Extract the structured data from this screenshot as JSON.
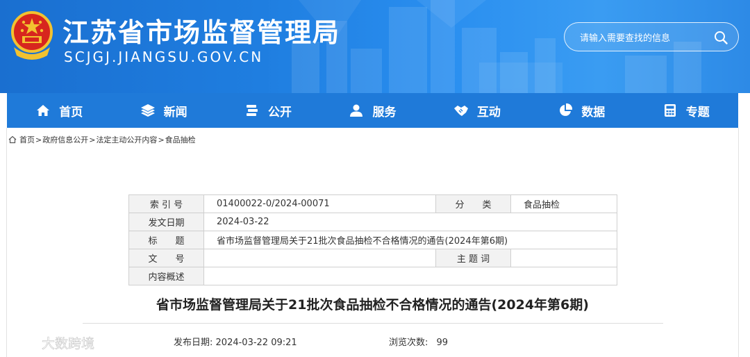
{
  "header": {
    "site_title": "江苏省市场监督管理局",
    "site_domain": "SCJGJ.JIANGSU.GOV.CN",
    "search_placeholder": "请输入需要查找的信息"
  },
  "nav": {
    "items": [
      {
        "label": "首页",
        "icon": "home-icon"
      },
      {
        "label": "新闻",
        "icon": "layers-icon"
      },
      {
        "label": "公开",
        "icon": "stack-icon"
      },
      {
        "label": "服务",
        "icon": "user-icon"
      },
      {
        "label": "互动",
        "icon": "handshake-icon"
      },
      {
        "label": "数据",
        "icon": "pie-chart-icon"
      },
      {
        "label": "专题",
        "icon": "calculator-icon"
      }
    ]
  },
  "breadcrumb": {
    "items": [
      "首页",
      "政府信息公开",
      "法定主动公开内容",
      "食品抽检"
    ],
    "separator": ">"
  },
  "info_table": {
    "index_label": "索 引 号",
    "index_value": "01400022-0/2024-00071",
    "category_label": "分　　类",
    "category_value": "食品抽检",
    "date_label": "发文日期",
    "date_value": "2024-03-22",
    "title_label": "标　　题",
    "title_value": "省市场监督管理局关于21批次食品抽检不合格情况的通告(2024年第6期)",
    "doc_no_label": "文　　号",
    "doc_no_value": "",
    "keywords_label": "主 题 词",
    "keywords_value": "",
    "summary_label": "内容概述",
    "summary_value": ""
  },
  "article": {
    "title": "省市场监督管理局关于21批次食品抽检不合格情况的通告(2024年第6期)",
    "publish_label": "发布日期:",
    "publish_value": "2024-03-22 09:21",
    "views_label": "浏览次数:",
    "views_value": "99"
  },
  "watermark": {
    "text": "大数跨境"
  },
  "colors": {
    "header_blue": "#1f7ee0",
    "nav_blue": "#1f7ad9",
    "table_label_bg": "#f2f2f2",
    "table_border": "#cfcfcf"
  }
}
